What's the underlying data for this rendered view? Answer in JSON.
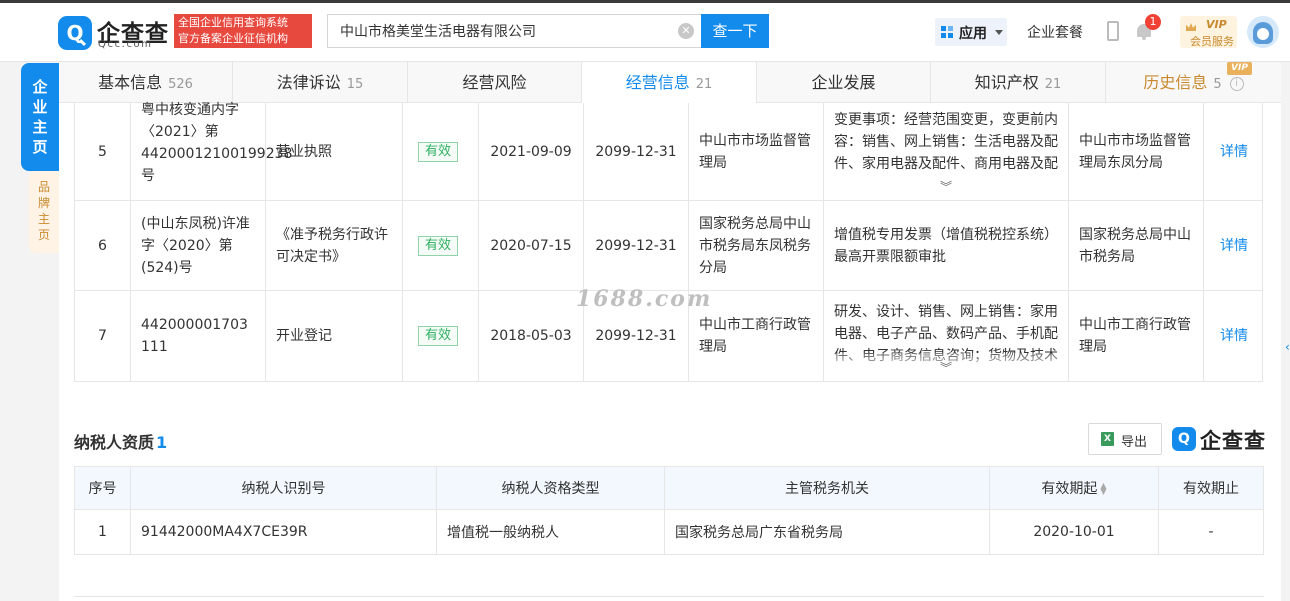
{
  "header": {
    "logo_name": "企查查",
    "logo_domain": "Qcc.com",
    "slogan_line1": "全国企业信用查询系统",
    "slogan_line2": "官方备案企业征信机构",
    "search_value": "中山市格美堂生活电器有限公司",
    "search_button": "查一下",
    "apps_label": "应用",
    "package_label": "企业套餐",
    "notification_count": "1",
    "vip_label": "VIP",
    "vip_sub": "会员服务"
  },
  "side": {
    "main": [
      "企",
      "业",
      "主",
      "页"
    ],
    "brand": [
      "品",
      "牌",
      "主",
      "页"
    ]
  },
  "tabs": [
    {
      "label": "基本信息",
      "count": "526"
    },
    {
      "label": "法律诉讼",
      "count": "15"
    },
    {
      "label": "经营风险",
      "count": ""
    },
    {
      "label": "经营信息",
      "count": "21"
    },
    {
      "label": "企业发展",
      "count": ""
    },
    {
      "label": "知识产权",
      "count": "21"
    },
    {
      "label": "历史信息",
      "count": "5",
      "badge": "VIP"
    }
  ],
  "licenses": [
    {
      "no": "5",
      "doc_no": "粤中核变通内字〈2021〉第44200012100199238号",
      "doc_name": "营业执照",
      "status": "有效",
      "start": "2021-09-09",
      "end": "2099-12-31",
      "authority": "中山市市场监督管理局",
      "content": "变更事项：经营范围变更，变更前内容：销售、网上销售：生活电器及配件、家用电器及配件、商用电器及配",
      "source": "中山市市场监督管理局东凤分局",
      "action": "详情"
    },
    {
      "no": "6",
      "doc_no": "(中山东凤税)许准字〈2020〉第(524)号",
      "doc_name": "《准予税务行政许可决定书》",
      "status": "有效",
      "start": "2020-07-15",
      "end": "2099-12-31",
      "authority": "国家税务总局中山市税务局东凤税务分局",
      "content": "增值税专用发票（增值税税控系统）最高开票限额审批",
      "source": "国家税务总局中山市税务局",
      "action": "详情"
    },
    {
      "no": "7",
      "doc_no": "442000001703111",
      "doc_name": "开业登记",
      "status": "有效",
      "start": "2018-05-03",
      "end": "2099-12-31",
      "authority": "中山市工商行政管理局",
      "content": "研发、设计、销售、网上销售：家用电器、电子产品、数码产品、手机配件、电子商务信息咨询；货物及技术",
      "source": "中山市工商行政管理局",
      "action": "详情"
    }
  ],
  "watermark": "1688.com",
  "tax": {
    "title": "纳税人资质",
    "count": "1",
    "export_label": "导出",
    "brand": "企查查",
    "columns": [
      "序号",
      "纳税人识别号",
      "纳税人资格类型",
      "主管税务机关",
      "有效期起",
      "有效期止"
    ],
    "rows": [
      {
        "no": "1",
        "tax_id": "91442000MA4X7CE39R",
        "type": "增值税一般纳税人",
        "authority": "国家税务总局广东省税务局",
        "start": "2020-10-01",
        "end": "-"
      }
    ]
  },
  "colors": {
    "primary": "#128bed",
    "valid": "#2eb060",
    "vip": "#c98a2f",
    "slogan_bg": "#e8493f"
  }
}
